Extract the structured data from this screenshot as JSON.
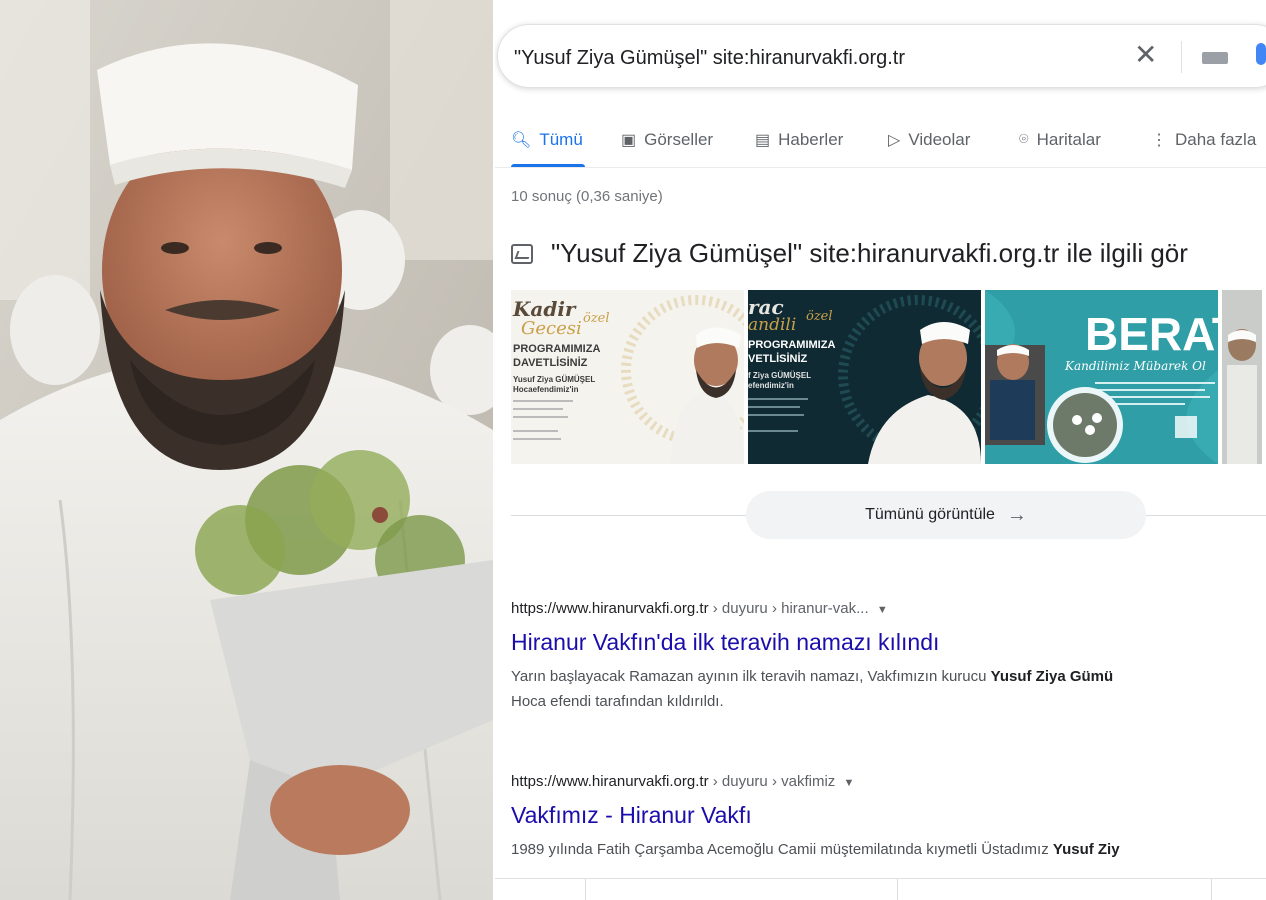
{
  "photo": {
    "alt_icon": "man-with-flowers-photo"
  },
  "search": {
    "query": "\"Yusuf Ziya Gümüşel\" site:hiranurvakfi.org.tr",
    "clear_icon": "close-icon",
    "keyboard_icon": "keyboard-icon",
    "mic_icon": "microphone-icon"
  },
  "tabs": [
    {
      "label": "Tümü",
      "icon": "search-icon",
      "active": true
    },
    {
      "label": "Görseller",
      "icon": "image-icon"
    },
    {
      "label": "Haberler",
      "icon": "news-icon"
    },
    {
      "label": "Videolar",
      "icon": "video-icon"
    },
    {
      "label": "Haritalar",
      "icon": "map-pin-icon"
    },
    {
      "label": "Daha fazla",
      "icon": "more-vert-icon"
    }
  ],
  "stats": "10 sonuç (0,36 saniye)",
  "images_section": {
    "heading": "\"Yusuf Ziya Gümüşel\" site:hiranurvakfi.org.tr ile ilgili gör",
    "thumb1": {
      "title1": "Kadir",
      "title2": "Gecesi",
      "tag": "özel",
      "line1": "PROGRAMIMIZA",
      "line2": "DAVETLİSİNİZ",
      "line3": "Yusuf Ziya GÜMÜŞEL",
      "line4": "Hocaefendimiz'in"
    },
    "thumb2": {
      "title1": "rac",
      "title2": "andili",
      "tag": "özel",
      "line1": "PROGRAMIMIZA",
      "line2": "VETLİSİNİZ",
      "line3": "f Ziya GÜMÜŞEL",
      "line4": "efendimiz'in"
    },
    "thumb3": {
      "title": "BERAT",
      "subtitle": "Kandilimiz Mübarek Ol"
    },
    "view_all": "Tümünü görüntüle",
    "view_all_icon": "arrow-right-icon"
  },
  "results": [
    {
      "url_base": "https://www.hiranurvakfi.org.tr",
      "url_path": " › duyuru › hiranur-vak...",
      "title": "Hiranur Vakfın'da ilk teravih namazı kılındı",
      "snippet_pre": "Yarın başlayacak Ramazan ayının ilk teravih namazı, Vakfımızın kurucu ",
      "snippet_bold": "Yusuf Ziya Gümü",
      "snippet_line2": "Hoca efendi tarafından kıldırıldı."
    },
    {
      "url_base": "https://www.hiranurvakfi.org.tr",
      "url_path": " › duyuru › vakfimiz",
      "title": "Vakfımız - Hiranur Vakfı",
      "snippet_pre": "1989 yılında Fatih Çarşamba Acemoğlu Camii müştemilatında kıymetli Üstadımız ",
      "snippet_bold": "Yusuf Ziy",
      "snippet_line2": ""
    }
  ],
  "colors": {
    "link": "#1a0dab",
    "accent": "#1a73e8",
    "text": "#202124",
    "muted": "#70757a"
  }
}
